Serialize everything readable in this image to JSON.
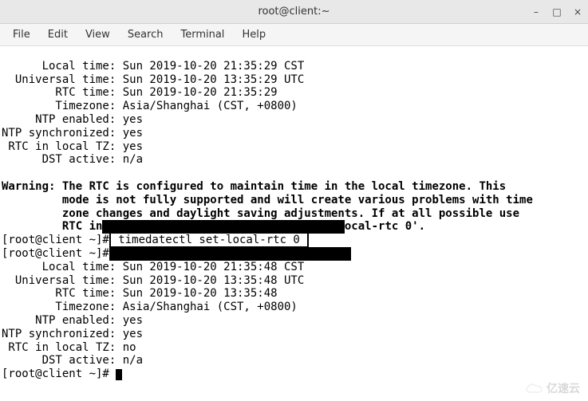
{
  "window": {
    "title": "root@client:~",
    "controls": {
      "min": "–",
      "max": "□",
      "close": "×"
    }
  },
  "menubar": {
    "items": [
      "File",
      "Edit",
      "View",
      "Search",
      "Terminal",
      "Help"
    ]
  },
  "terminal": {
    "block1": {
      "l1": "      Local time: Sun 2019-10-20 21:35:29 CST",
      "l2": "  Universal time: Sun 2019-10-20 13:35:29 UTC",
      "l3": "        RTC time: Sun 2019-10-20 21:35:29",
      "l4": "        Timezone: Asia/Shanghai (CST, +0800)",
      "l5": "     NTP enabled: yes",
      "l6": "NTP synchronized: yes",
      "l7": " RTC in local TZ: yes",
      "l8": "      DST active: n/a"
    },
    "warning": {
      "w1": "Warning: The RTC is configured to maintain time in the local timezone. This",
      "w2": "         mode is not fully supported and will create various problems with time",
      "w3": "         zone changes and daylight saving adjustments. If at all possible use",
      "w4a": "         RTC in",
      "w4b": "ocal-rtc 0'."
    },
    "cmd": {
      "prompt1": "[root@client ~]#",
      "boxed": " timedatectl set-local-rtc 0 ",
      "prompt2": "[root@client ~]#"
    },
    "block2": {
      "l1": "      Local time: Sun 2019-10-20 21:35:48 CST",
      "l2": "  Universal time: Sun 2019-10-20 13:35:48 UTC",
      "l3": "        RTC time: Sun 2019-10-20 13:35:48",
      "l4": "        Timezone: Asia/Shanghai (CST, +0800)",
      "l5": "     NTP enabled: yes",
      "l6": "NTP synchronized: yes",
      "l7": " RTC in local TZ: no",
      "l8": "      DST active: n/a"
    },
    "prompt_final": "[root@client ~]# "
  },
  "watermark": "亿速云"
}
